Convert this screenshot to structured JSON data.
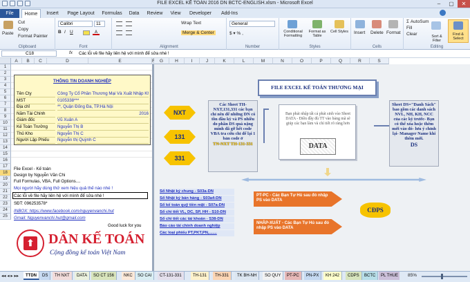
{
  "window": {
    "title": "FILE EXCEL KẾ TOÁN 2016 DN BCTC-ENGLISH.xlsm - Microsoft Excel",
    "min": "–",
    "max": "▢",
    "close": "✕"
  },
  "tabs": [
    "File",
    "Home",
    "Insert",
    "Page Layout",
    "Formulas",
    "Data",
    "Review",
    "View",
    "Developer",
    "Add-Ins"
  ],
  "ribbon": {
    "paste": "Paste",
    "cut": "Cut",
    "copy": "Copy",
    "format_painter": "Format Painter",
    "clipboard": "Clipboard",
    "font_name": "Calibri",
    "font_size": "11",
    "font_group": "Font",
    "wrap": "Wrap Text",
    "merge": "Merge & Center",
    "alignment": "Alignment",
    "number_format": "General",
    "number": "Number",
    "cond": "Conditional Formatting",
    "table": "Format as Table",
    "cellstyles": "Cell Styles",
    "styles": "Styles",
    "insert": "Insert",
    "delete": "Delete",
    "format": "Format",
    "cells": "Cells",
    "sum": "Σ AutoSum",
    "fill": "Fill",
    "clear": "Clear",
    "sort": "Sort & Filter",
    "find": "Find & Select",
    "editing": "Editing"
  },
  "formula_bar": {
    "cell_ref": "C18",
    "fx": "fx",
    "content": "Các lỗi về file hãy liên hệ với mình để sửa nhé !"
  },
  "columns": [
    "A",
    "B",
    "C",
    "D",
    "E",
    "F",
    "G",
    "H",
    "I",
    "J",
    "K",
    "L",
    "M",
    "N",
    "O",
    "P",
    "Q",
    "R",
    "S"
  ],
  "rows": [
    "1",
    "2",
    "3",
    "4",
    "5",
    "6",
    "7",
    "8",
    "9",
    "10",
    "11",
    "12",
    "13",
    "14",
    "15",
    "16",
    "17",
    "18",
    "19",
    "20",
    "21",
    "22",
    "23",
    "24",
    "25"
  ],
  "info": {
    "title": "THÔNG TIN DOANH NGHIỆP",
    "rows": [
      {
        "label": "Tên Cty",
        "value": "Công Ty Cổ Phần Thương Mại Và Xuất Nhập Khẩu ***"
      },
      {
        "label": "MST",
        "value": "0105338***"
      },
      {
        "label": "Địa chỉ",
        "value": "**, Quận Đống Đa, TP.Hà Nội"
      },
      {
        "label": "Năm Tài Chính",
        "value": "2016"
      },
      {
        "label": "Giám đốc",
        "value": "Vũ Xuân A"
      },
      {
        "label": "Kế Toán Trưởng",
        "value": "Nguyễn Thị B"
      },
      {
        "label": "Thủ Kho",
        "value": "Nguyễn Thị C"
      },
      {
        "label": "Người Lập Phiếu",
        "value": "Nguyễn thị Quỳnh C"
      }
    ]
  },
  "notes": [
    "Flie Excel - Kế toán",
    "Design by Nguyễn Văn Chi",
    "Full Formulas, VBA, Full Options....",
    "Mọi người hãy dùng thử xem hiệu quả thế nào nhé !",
    "Các lỗi về file hãy liên hệ với mình để sửa nhé !",
    "SĐT: 096253578*",
    "INBOX: https://www.facebook.com/nguyenvanchi.hut",
    "Gmail: Nguyenvanchi.hut@gmail.com"
  ],
  "good_luck": "Good luck for you",
  "logo": {
    "name": "DÂN KẾ TOÁN",
    "tagline": "Cộng đồng kế toán Việt Nam"
  },
  "diagram": {
    "header": "FILE EXCEL KẾ TOÁN THƯƠNG MẠI",
    "hex": [
      "NXT",
      "131",
      "331"
    ],
    "left_box": "Các Sheet TH-NXT,131,331 các bạn chỉ nên để những DN có tồn đầu kỳ và PS nhiều do phần DS quá nặng mình đã gỡ hết code VBA tra cứu chỉ để lại 1 bản code ở",
    "left_box_code": "TN-NXT TH-131-331",
    "center_box": "Bạn phải nhập tất cả phát sinh vào Sheet DATA - Điền đầy đủ TT vào bảng mã sẽ giúp các bạn làm và chỉ tiết rõ ràng hơn",
    "center_label": "DATA",
    "right_box": "Sheet DS=\"Danh Sách\" bao gồm các danh sách NVL, NH, KH, NCC của các kỳ trước- Bạn có thể xóa hoặc thêm mới vào đó- lưu ý chỉnh lại- Manager Name khi thêm mới.",
    "right_label": "DS",
    "links": [
      "Sổ Nhật ký chung  - S03a-DN",
      "Sổ Nhật ký bán hàng - S03a4-DN",
      "Sổ kế toán quỹ tiền mặt - S07a-DN",
      "Sổ chi tiết VL, DC, SP, HH - S10-DN",
      "Sổ chi tiết các tài khoản - S38-DN",
      "Báo cáo tài chính doanh nghiệp",
      "Các loại phiếu PT,PKT,PN,......."
    ],
    "arrow1": "PT-PC -  Các Bạn Tự Hủ sau đó nhập PS vào DATA",
    "arrow2": "NHÂP-XUẤT - Các Bạn Tự Hủ sau đó nhập PS vào DATA",
    "cdps": "CĐPS"
  },
  "sheets": [
    "TTDN",
    "DS",
    "TH NXT",
    "DATA",
    "SO CT 156",
    "NKC",
    "SO CAI",
    "CT-131-331",
    "TH-131",
    "TH-331",
    "TK BH-NH",
    "SO QUY",
    "PT-PC",
    "PN-PX",
    "KH 242",
    "CDPS",
    "BCTC",
    "PL THUE",
    "Pl"
  ],
  "status": {
    "ready": "Ready",
    "zoom": "85%"
  },
  "colors": {
    "ribbon": "#2b579a",
    "hex": "#f7c300",
    "arrow": "#e8742a",
    "blue_link": "#1f2fbf",
    "info_bg": "#fff9c8",
    "logo_red": "#d52030"
  }
}
